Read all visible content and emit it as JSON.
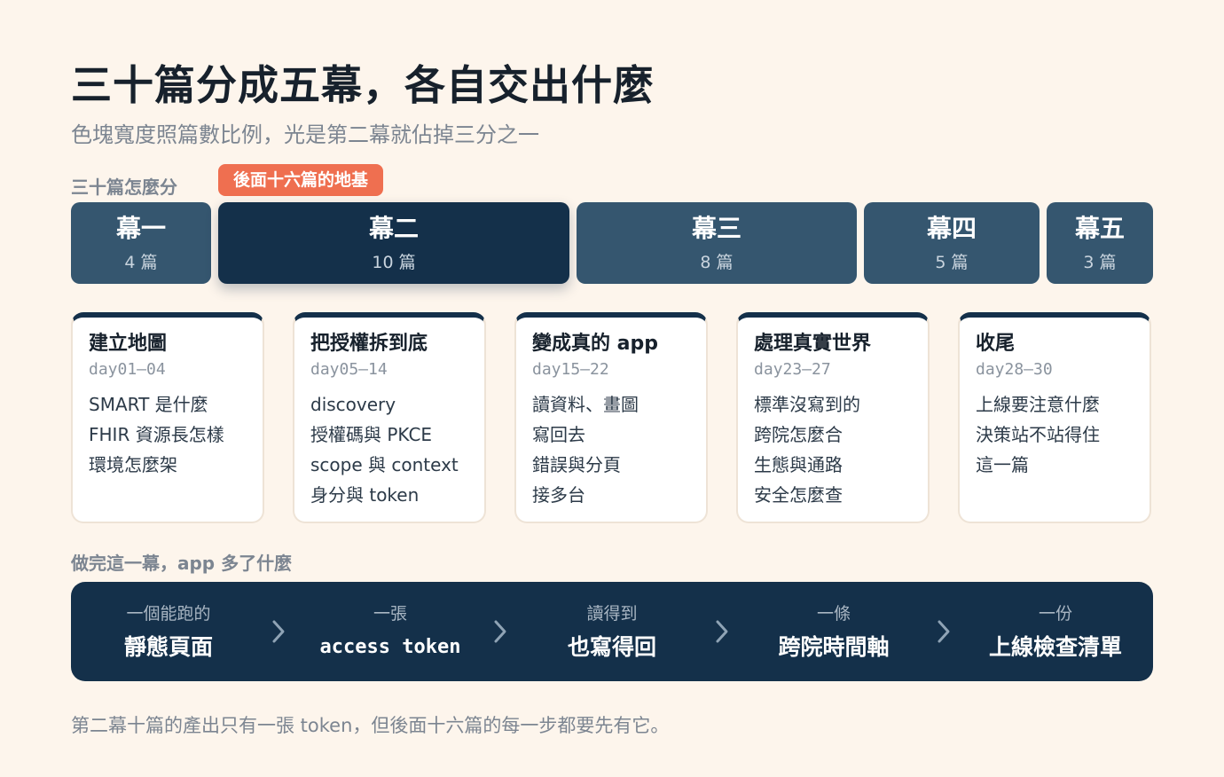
{
  "title": "三十篇分成五幕，各自交出什麼",
  "subtitle": "色塊寬度照篇數比例，光是第二幕就佔掉三分之一",
  "split_label": "三十篇怎麼分",
  "callout": "後面十六篇的地基",
  "acts": [
    {
      "name": "幕一",
      "count": "4 篇",
      "posts": 4
    },
    {
      "name": "幕二",
      "count": "10 篇",
      "posts": 10
    },
    {
      "name": "幕三",
      "count": "8 篇",
      "posts": 8
    },
    {
      "name": "幕四",
      "count": "5 篇",
      "posts": 5
    },
    {
      "name": "幕五",
      "count": "3 篇",
      "posts": 3
    }
  ],
  "cards": [
    {
      "title": "建立地圖",
      "days": "day01–04",
      "items": [
        "SMART 是什麼",
        "FHIR 資源長怎樣",
        "環境怎麼架"
      ]
    },
    {
      "title": "把授權拆到底",
      "days": "day05–14",
      "items": [
        "discovery",
        "授權碼與 PKCE",
        "scope 與 context",
        "身分與 token"
      ]
    },
    {
      "title": "變成真的 app",
      "days": "day15–22",
      "items": [
        "讀資料、畫圖",
        "寫回去",
        "錯誤與分頁",
        "接多台"
      ]
    },
    {
      "title": "處理真實世界",
      "days": "day23–27",
      "items": [
        "標準沒寫到的",
        "跨院怎麼合",
        "生態與通路",
        "安全怎麼查"
      ]
    },
    {
      "title": "收尾",
      "days": "day28–30",
      "items": [
        "上線要注意什麼",
        "決策站不站得住",
        "這一篇"
      ]
    }
  ],
  "gain_label": "做完這一幕，app 多了什麼",
  "gains": [
    {
      "small": "一個能跑的",
      "big": "靜態頁面"
    },
    {
      "small": "一張",
      "big": "access token"
    },
    {
      "small": "讀得到",
      "big": "也寫得回"
    },
    {
      "small": "一條",
      "big": "跨院時間軸"
    },
    {
      "small": "一份",
      "big": "上線檢查清單"
    }
  ],
  "footnote": "第二幕十篇的產出只有一張 token，但後面十六篇的每一步都要先有它。",
  "colors": {
    "background": "#fdf5ec",
    "act": "#35566f",
    "act_featured": "#14304a",
    "callout": "#ef6f50",
    "gain_bar": "#14304a"
  },
  "icons": {
    "separator": "chevron-right-icon"
  }
}
